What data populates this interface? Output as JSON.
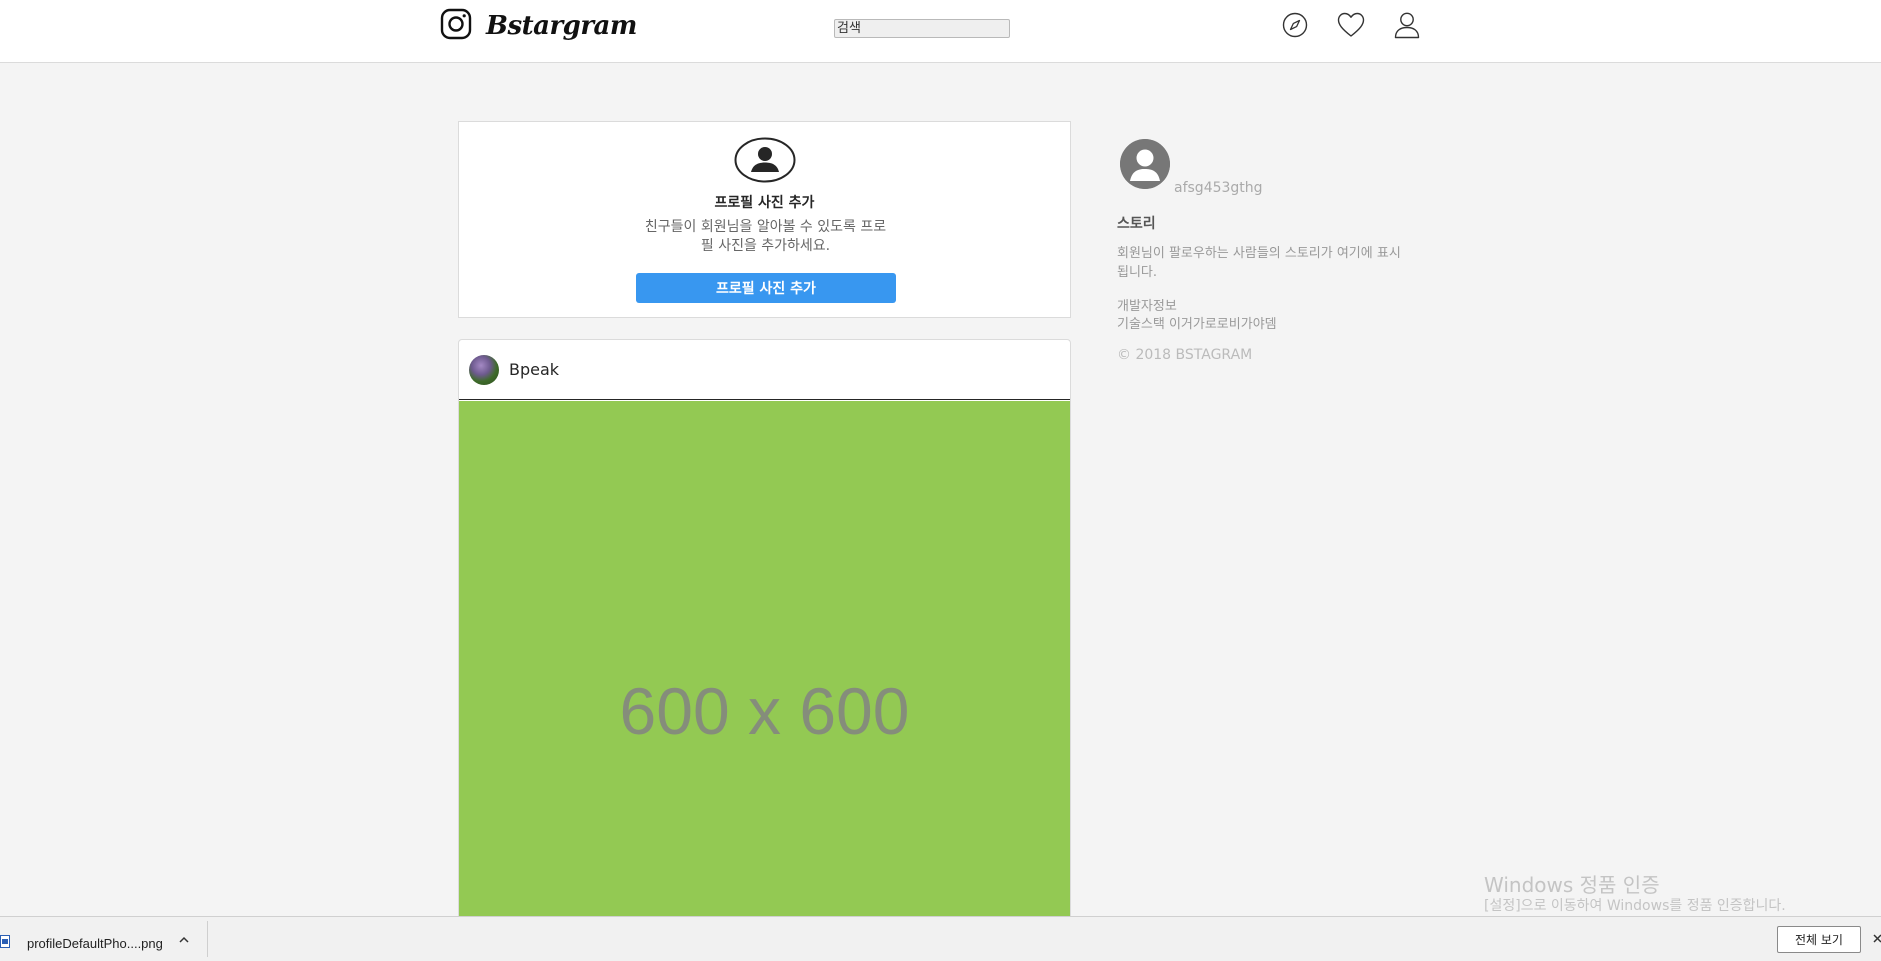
{
  "header": {
    "logo_text": "Bstargram",
    "search_placeholder": "검색",
    "icons": [
      "compass-icon",
      "heart-icon",
      "user-icon"
    ]
  },
  "profile_card": {
    "title": "프로필 사진 추가",
    "description": "친구들이 회원님을 알아볼 수 있도록 프로필 사진을 추가하세요.",
    "button_label": "프로필 사진 추가"
  },
  "post": {
    "username": "Bpeak",
    "image_placeholder": "600 x 600",
    "image_color": "#93c953"
  },
  "sidebar": {
    "username": "afsg453gthg",
    "story_title": "스토리",
    "story_description": "회원님이 팔로우하는 사람들의 스토리가 여기에 표시됩니다.",
    "dev_info": "개발자정보",
    "tech_stack": "기술스택 이거가로로비가야뎀",
    "copyright": "© 2018 BSTAGRAM"
  },
  "watermark": {
    "title": "Windows 정품 인증",
    "subtitle": "[설정]으로 이동하여 Windows를 정품 인증합니다."
  },
  "download_bar": {
    "filename": "profileDefaultPho....png",
    "show_all_label": "전체 보기"
  },
  "colors": {
    "accent": "#3897f0",
    "background": "#f4f4f4"
  }
}
